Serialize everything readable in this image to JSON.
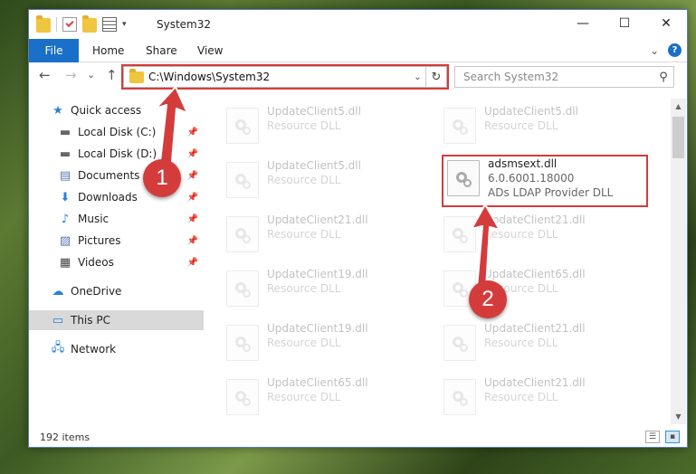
{
  "window": {
    "title": "System32",
    "controls": {
      "minimize": "—",
      "maximize": "☐",
      "close": "✕"
    }
  },
  "ribbon": {
    "tabs": [
      {
        "label": "File"
      },
      {
        "label": "Home"
      },
      {
        "label": "Share"
      },
      {
        "label": "View"
      }
    ]
  },
  "navigation": {
    "back": "←",
    "forward": "→",
    "recent": "⌄",
    "up": "↑",
    "address": "C:\\Windows\\System32",
    "search_placeholder": "Search System32"
  },
  "sidebar": {
    "items": [
      {
        "label": "Quick access",
        "icon": "star-icon",
        "pinned": false
      },
      {
        "label": "Local Disk (C:)",
        "icon": "drive-icon",
        "pinned": true
      },
      {
        "label": "Local Disk (D:)",
        "icon": "drive-icon",
        "pinned": true
      },
      {
        "label": "Documents",
        "icon": "documents-icon",
        "pinned": true
      },
      {
        "label": "Downloads",
        "icon": "downloads-icon",
        "pinned": true
      },
      {
        "label": "Music",
        "icon": "music-icon",
        "pinned": true
      },
      {
        "label": "Pictures",
        "icon": "pictures-icon",
        "pinned": true
      },
      {
        "label": "Videos",
        "icon": "videos-icon",
        "pinned": true
      },
      {
        "label": "OneDrive",
        "icon": "cloud-icon",
        "pinned": false
      },
      {
        "label": "This PC",
        "icon": "computer-icon",
        "pinned": false,
        "selected": true
      },
      {
        "label": "Network",
        "icon": "network-icon",
        "pinned": false
      }
    ]
  },
  "files": {
    "left_column": [
      {
        "name": "UpdateClient5.dll",
        "desc": "Resource DLL"
      },
      {
        "name": "UpdateClient5.dll",
        "desc": "Resource DLL"
      },
      {
        "name": "UpdateClient21.dll",
        "desc": "Resource DLL"
      },
      {
        "name": "UpdateClient19.dll",
        "desc": "Resource DLL"
      },
      {
        "name": "UpdateClient19.dll",
        "desc": "Resource DLL"
      },
      {
        "name": "UpdateClient65.dll",
        "desc": "Resource DLL"
      }
    ],
    "right_column": [
      {
        "name": "UpdateClient5.dll",
        "desc": "Resource DLL"
      },
      {
        "name": "adsmsext.dll",
        "desc": "6.0.6001.18000",
        "desc2": "ADs LDAP Provider DLL",
        "highlighted": true
      },
      {
        "name": "UpdateClient21.dll",
        "desc": "Resource DLL"
      },
      {
        "name": "UpdateClient65.dll",
        "desc": "Resource DLL"
      },
      {
        "name": "UpdateClient21.dll",
        "desc": "Resource DLL"
      },
      {
        "name": "UpdateClient21.dll",
        "desc": "Resource DLL"
      }
    ]
  },
  "status": {
    "item_count": "192 items"
  },
  "annotations": [
    {
      "label": "1",
      "color": "#d43c3c"
    },
    {
      "label": "2",
      "color": "#d43c3c"
    }
  ],
  "colors": {
    "accent": "#1a6fc8",
    "highlight": "#d43c3c"
  }
}
